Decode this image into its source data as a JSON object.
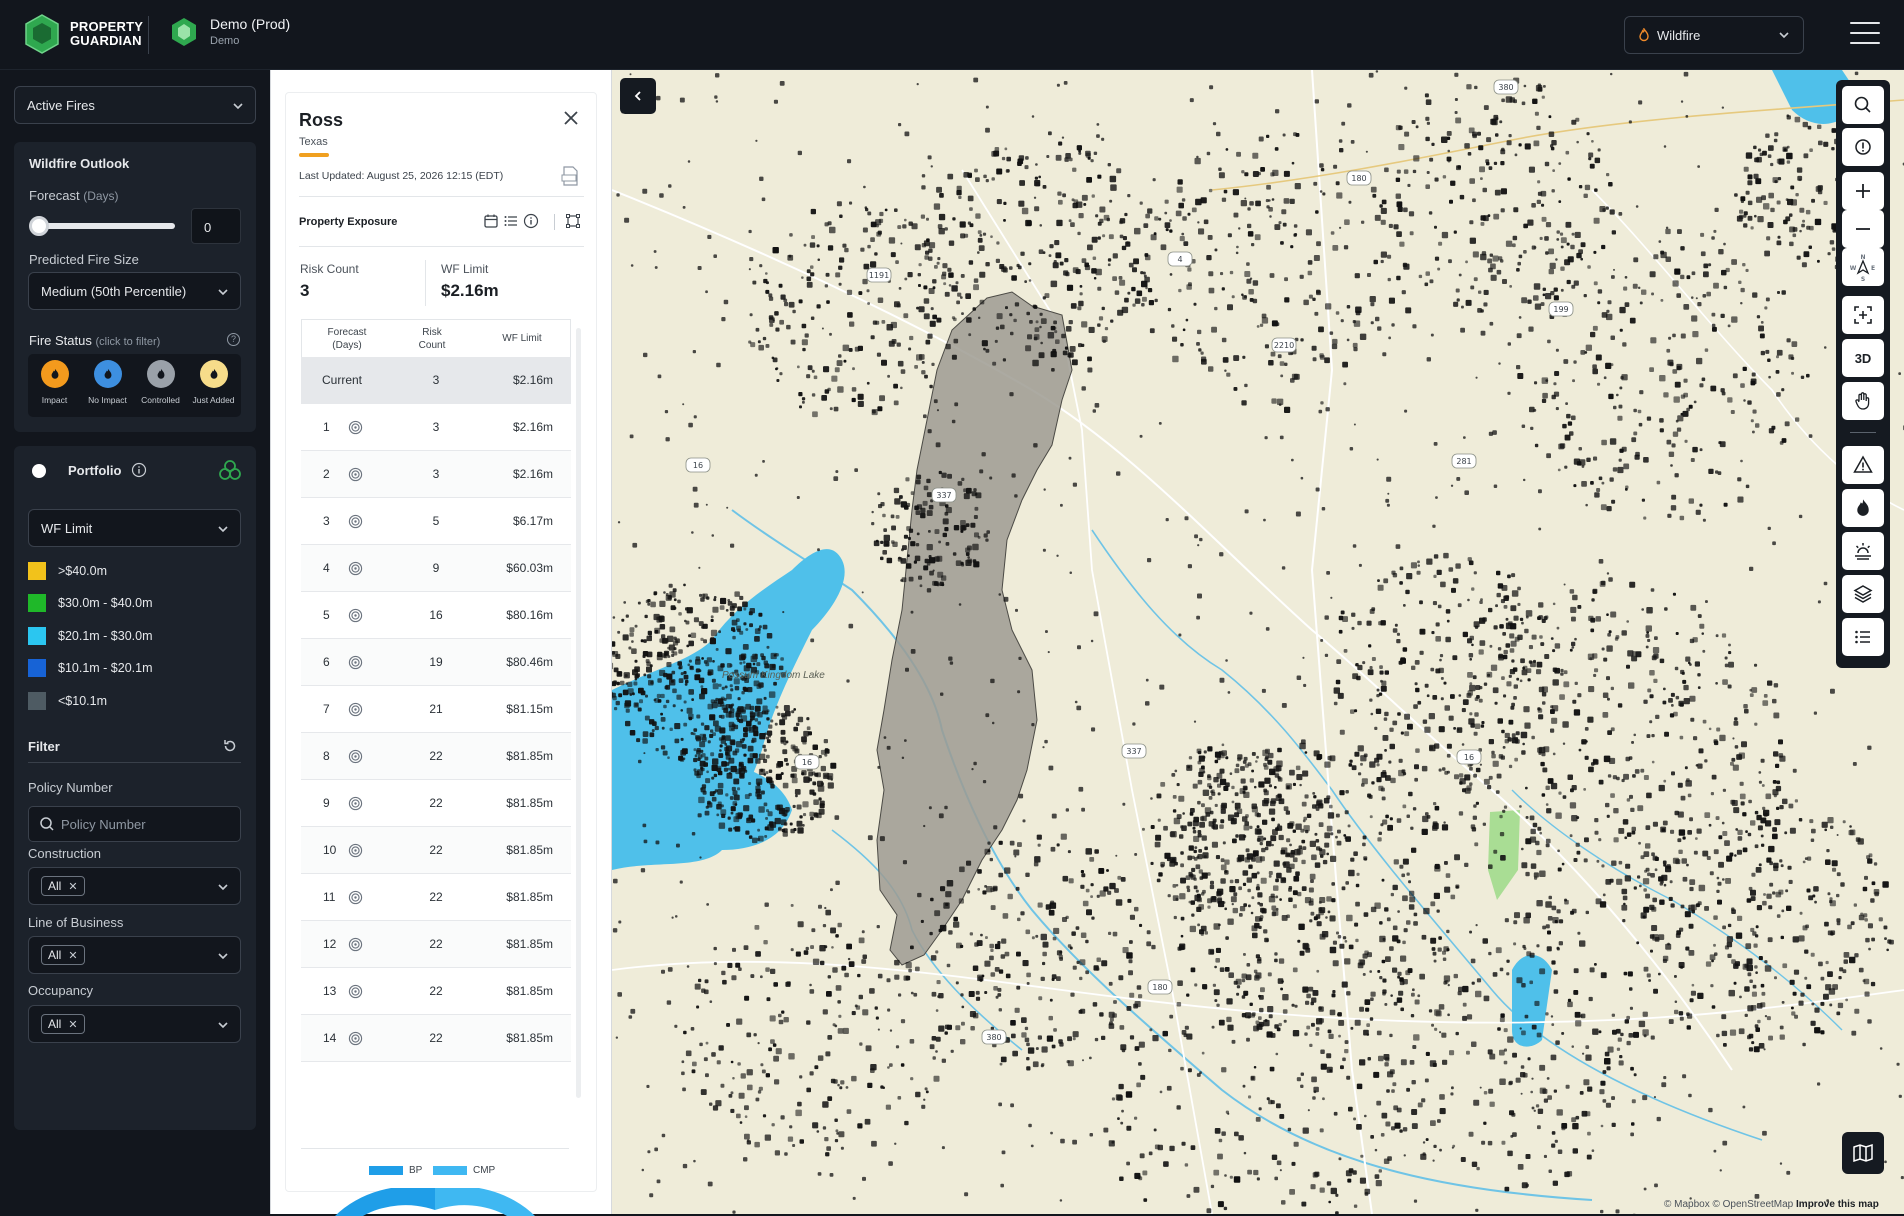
{
  "header": {
    "brand_line1": "PROPERTY",
    "brand_line2": "GUARDIAN",
    "org_name": "Demo (Prod)",
    "org_sub": "Demo",
    "hazard_select": "Wildfire"
  },
  "sidebar": {
    "view_select": "Active Fires",
    "outlook_title": "Wildfire Outlook",
    "forecast_label": "Forecast",
    "forecast_unit": "(Days)",
    "forecast_value": "0",
    "forecast_fraction": 0,
    "fire_size_label": "Predicted Fire Size",
    "fire_size_value": "Medium (50th Percentile)",
    "fire_status_label": "Fire Status",
    "fire_status_hint": "(click to filter)",
    "statuses": [
      {
        "label": "Impact",
        "color": "#f39a1d"
      },
      {
        "label": "No Impact",
        "color": "#3d8fe0"
      },
      {
        "label": "Controlled",
        "color": "#9aa1a9"
      },
      {
        "label": "Just Added",
        "color": "#f6dc8a"
      }
    ],
    "portfolio_label": "Portfolio",
    "metric_select": "WF Limit",
    "legend": [
      {
        "label": ">$40.0m",
        "color": "#f2c21b"
      },
      {
        "label": "$30.0m - $40.0m",
        "color": "#1fb829"
      },
      {
        "label": "$20.1m - $30.0m",
        "color": "#2bc6f0"
      },
      {
        "label": "$10.1m - $20.1m",
        "color": "#1763d6"
      },
      {
        "label": "<$10.1m",
        "color": "#4e5b63"
      }
    ],
    "filter_label": "Filter",
    "policy_label": "Policy Number",
    "policy_placeholder": "Policy Number",
    "construction_label": "Construction",
    "construction_value": "All",
    "lob_label": "Line of Business",
    "lob_value": "All",
    "occupancy_label": "Occupancy",
    "occupancy_value": "All"
  },
  "detail": {
    "title": "Ross",
    "subtitle": "Texas",
    "updated": "Last Updated: August 25, 2026 12:15 (EDT)",
    "exposure_label": "Property Exposure",
    "risk_count_label": "Risk Count",
    "risk_count_value": "3",
    "wf_limit_label": "WF Limit",
    "wf_limit_value": "$2.16m",
    "table_headers": {
      "forecast": "Forecast (Days)",
      "risk": "Risk Count",
      "limit": "WF Limit"
    },
    "rows": [
      {
        "day": "Current",
        "risk": "3",
        "limit": "$2.16m"
      },
      {
        "day": "1",
        "risk": "3",
        "limit": "$2.16m"
      },
      {
        "day": "2",
        "risk": "3",
        "limit": "$2.16m"
      },
      {
        "day": "3",
        "risk": "5",
        "limit": "$6.17m"
      },
      {
        "day": "4",
        "risk": "9",
        "limit": "$60.03m"
      },
      {
        "day": "5",
        "risk": "16",
        "limit": "$80.16m"
      },
      {
        "day": "6",
        "risk": "19",
        "limit": "$80.46m"
      },
      {
        "day": "7",
        "risk": "21",
        "limit": "$81.15m"
      },
      {
        "day": "8",
        "risk": "22",
        "limit": "$81.85m"
      },
      {
        "day": "9",
        "risk": "22",
        "limit": "$81.85m"
      },
      {
        "day": "10",
        "risk": "22",
        "limit": "$81.85m"
      },
      {
        "day": "11",
        "risk": "22",
        "limit": "$81.85m"
      },
      {
        "day": "12",
        "risk": "22",
        "limit": "$81.85m"
      },
      {
        "day": "13",
        "risk": "22",
        "limit": "$81.85m"
      },
      {
        "day": "14",
        "risk": "22",
        "limit": "$81.85m"
      }
    ],
    "chart_legend": [
      {
        "label": "BP",
        "color": "#1f9ee8"
      },
      {
        "label": "CMP",
        "color": "#3fb8f2"
      }
    ]
  },
  "map": {
    "tool_3d": "3D",
    "attribution_1": "© Mapbox © OpenStreetMap",
    "attribution_2": "Improve this map",
    "labels": {
      "lake": "Possum Kingdom Lake"
    },
    "road_shields": [
      "380",
      "180",
      "1191",
      "337",
      "16",
      "4",
      "2210",
      "199",
      "281",
      "16",
      "180",
      "380",
      "337",
      "16"
    ]
  }
}
